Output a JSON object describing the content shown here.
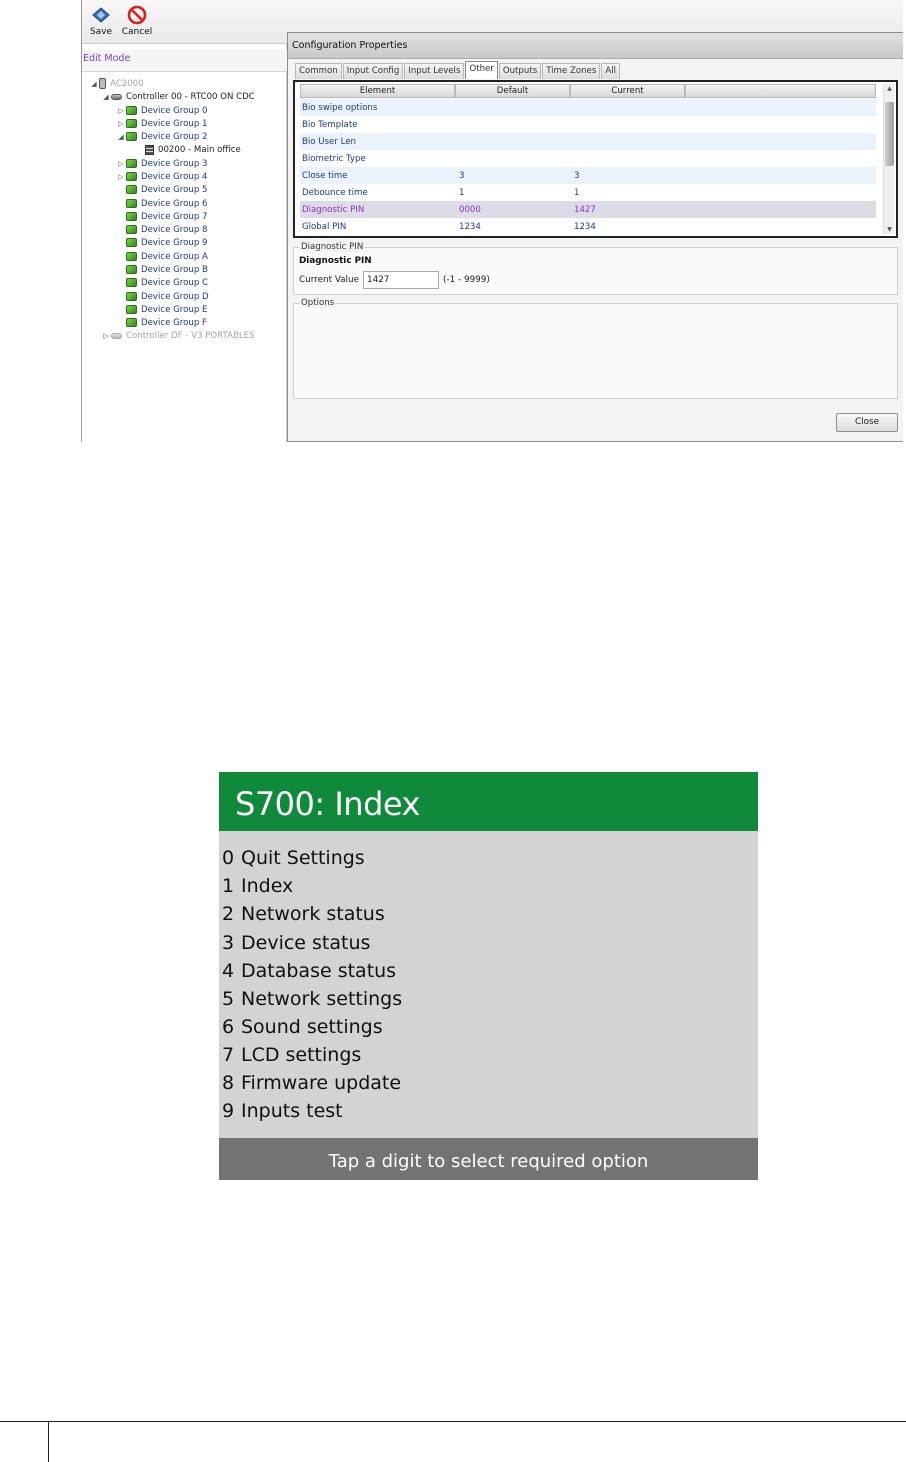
{
  "toolbar": {
    "save_label": "Save",
    "cancel_label": "Cancel"
  },
  "left_pane": {
    "mode_label": "Edit Mode",
    "tree": [
      {
        "label": "AC2000",
        "icon": "server-icon"
      },
      {
        "label": "Controller 00 - RTC00 ON CDC",
        "icon": "controller-icon"
      },
      {
        "label": "Device Group 0",
        "icon": "device-group-icon"
      },
      {
        "label": "Device Group 1",
        "icon": "device-group-icon"
      },
      {
        "label": "Device Group 2",
        "icon": "device-group-icon"
      },
      {
        "label": "00200 - Main office",
        "icon": "door-device-icon"
      },
      {
        "label": "Device Group 3",
        "icon": "device-group-icon"
      },
      {
        "label": "Device Group 4",
        "icon": "device-group-icon"
      },
      {
        "label": "Device Group 5",
        "icon": "device-group-icon"
      },
      {
        "label": "Device Group 6",
        "icon": "device-group-icon"
      },
      {
        "label": "Device Group 7",
        "icon": "device-group-icon"
      },
      {
        "label": "Device Group 8",
        "icon": "device-group-icon"
      },
      {
        "label": "Device Group 9",
        "icon": "device-group-icon"
      },
      {
        "label": "Device Group A",
        "icon": "device-group-icon"
      },
      {
        "label": "Device Group B",
        "icon": "device-group-icon"
      },
      {
        "label": "Device Group C",
        "icon": "device-group-icon"
      },
      {
        "label": "Device Group D",
        "icon": "device-group-icon"
      },
      {
        "label": "Device Group E",
        "icon": "device-group-icon"
      },
      {
        "label": "Device Group F",
        "icon": "device-group-icon"
      },
      {
        "label": "Controller DF - V3 PORTABLES",
        "icon": "controller-icon"
      }
    ]
  },
  "config": {
    "title": "Configuration Properties",
    "tabs": [
      "Common",
      "Input Config",
      "Input Levels",
      "Other",
      "Outputs",
      "Time Zones",
      "All"
    ],
    "active_tab": "Other",
    "columns": [
      "Element",
      "Default",
      "Current"
    ],
    "rows": [
      {
        "element": "Bio swipe options",
        "default": "",
        "current": ""
      },
      {
        "element": "Bio Template",
        "default": "",
        "current": ""
      },
      {
        "element": "Bio User Len",
        "default": "",
        "current": ""
      },
      {
        "element": "Biometric Type",
        "default": "",
        "current": ""
      },
      {
        "element": "Close time",
        "default": "3",
        "current": "3"
      },
      {
        "element": "Debounce time",
        "default": "1",
        "current": "1"
      },
      {
        "element": "Diagnostic PIN",
        "default": "0000",
        "current": "1427"
      },
      {
        "element": "Global PIN",
        "default": "1234",
        "current": "1234"
      }
    ],
    "selected_row": "Diagnostic PIN",
    "detail": {
      "legend": "Diagnostic PIN",
      "name": "Diagnostic PIN",
      "current_value_label": "Current Value",
      "current_value": "1427",
      "range": "(-1 - 9999)"
    },
    "options_legend": "Options",
    "close_label": "Close"
  },
  "s700": {
    "title": "S700: Index",
    "menu": [
      {
        "digit": "0",
        "label": "Quit Settings"
      },
      {
        "digit": "1",
        "label": "Index"
      },
      {
        "digit": "2",
        "label": "Network status"
      },
      {
        "digit": "3",
        "label": "Device status"
      },
      {
        "digit": "4",
        "label": "Database status"
      },
      {
        "digit": "5",
        "label": "Network settings"
      },
      {
        "digit": "6",
        "label": "Sound settings"
      },
      {
        "digit": "7",
        "label": "LCD settings"
      },
      {
        "digit": "8",
        "label": "Firmware update"
      },
      {
        "digit": "9",
        "label": "Inputs test"
      }
    ],
    "footer": "Tap a digit to select required option"
  },
  "colors": {
    "s700_header": "#0f8a3a",
    "s700_body": "#d4d2d3",
    "s700_footer": "#737373",
    "selected_row_text": "#8a33c9",
    "tree_text": "#1d3b8c"
  }
}
